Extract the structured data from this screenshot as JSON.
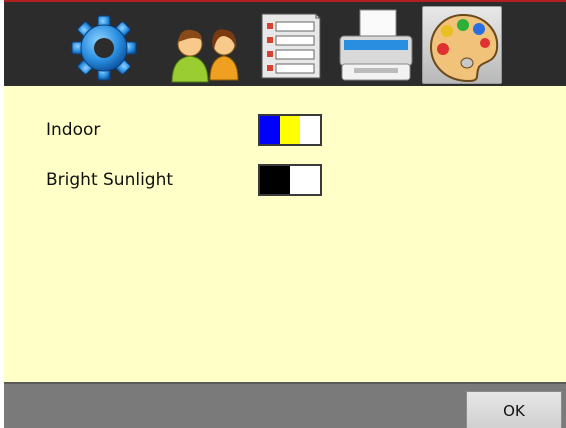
{
  "toolbar": {
    "tabs": [
      {
        "icon": "gear-icon",
        "active": false
      },
      {
        "icon": "users-icon",
        "active": false
      },
      {
        "icon": "list-icon",
        "active": false
      },
      {
        "icon": "printer-icon",
        "active": false
      },
      {
        "icon": "palette-icon",
        "active": true
      }
    ]
  },
  "themes": [
    {
      "label": "Indoor",
      "colors": [
        "#0000ff",
        "#ffff00",
        "#ffffff"
      ]
    },
    {
      "label": "Bright Sunlight",
      "colors": [
        "#000000",
        "#ffffff"
      ]
    }
  ],
  "footer": {
    "ok_label": "OK"
  },
  "colors": {
    "content_bg": "#ffffc8",
    "toolbar_bg": "#2c2c2c",
    "footer_bg": "#7a7a7a"
  }
}
